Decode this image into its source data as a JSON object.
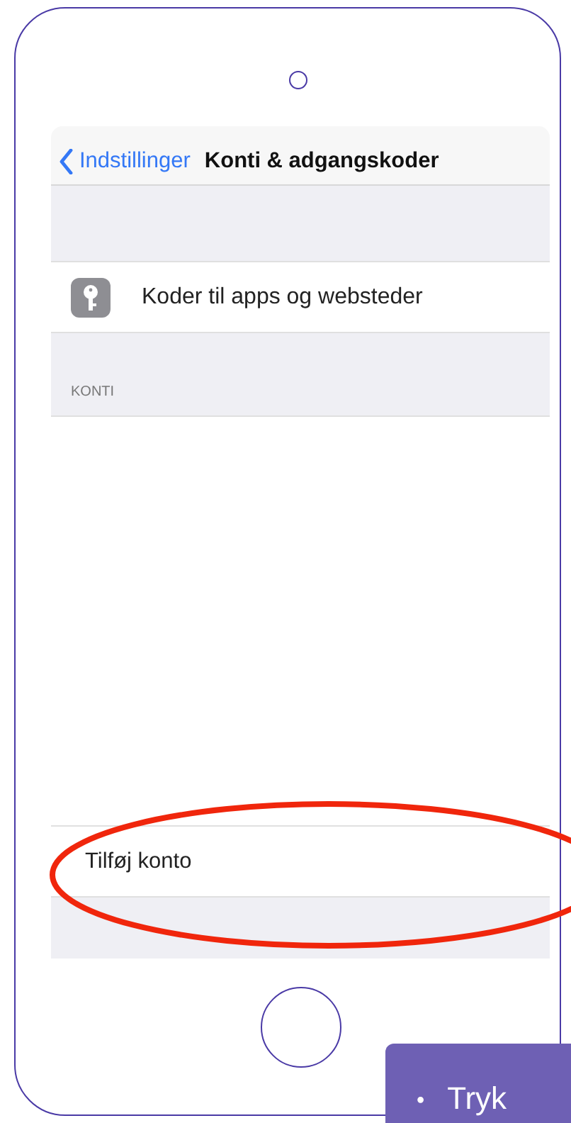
{
  "nav": {
    "back": "Indstillinger",
    "title": "Konti & adgangskoder"
  },
  "rows": [
    {
      "label": "Koder til apps og websteder"
    }
  ],
  "section_header": "KONTI",
  "add_account": {
    "label": "Tilføj konto",
    "highlighted": true
  },
  "callout": {
    "bullet": "•",
    "text": "Tryk"
  }
}
